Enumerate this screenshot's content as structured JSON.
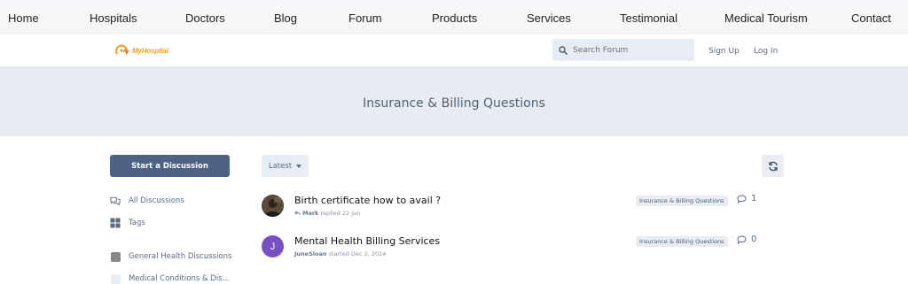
{
  "nav": {
    "items": [
      "Home",
      "Hospitals",
      "Doctors",
      "Blog",
      "Forum",
      "Products",
      "Services",
      "Testimonial",
      "Medical Tourism",
      "Contact"
    ]
  },
  "header": {
    "logo_text": "MyHospital",
    "search_placeholder": "Search Forum",
    "signup": "Sign Up",
    "login": "Log In"
  },
  "hero": {
    "title": "Insurance & Billing Questions"
  },
  "sidebar": {
    "start_button": "Start a Discussion",
    "items": [
      {
        "label": "All Discussions",
        "icon": "discussions-icon"
      },
      {
        "label": "Tags",
        "icon": "tags-icon"
      },
      {
        "label": "General Health Discussions",
        "color": "#888888"
      },
      {
        "label": "Medical Conditions & Dis...",
        "color": "#e8ecf3"
      }
    ]
  },
  "toolbar": {
    "sort_label": "Latest",
    "refresh_icon": "refresh-icon"
  },
  "discussions": [
    {
      "title": "Birth certificate how to avail ?",
      "user": "Mark",
      "action": "replied 22 Jan",
      "tag": "Insurance & Billing Questions",
      "replies": "1"
    },
    {
      "title": "Mental Health Billing Services",
      "user": "JuneSloan",
      "action": "started Dec 2, 2024",
      "tag": "Insurance & Billing Questions",
      "replies": "0",
      "avatar_letter": "J",
      "avatar_color": "#7a4fc4"
    }
  ]
}
